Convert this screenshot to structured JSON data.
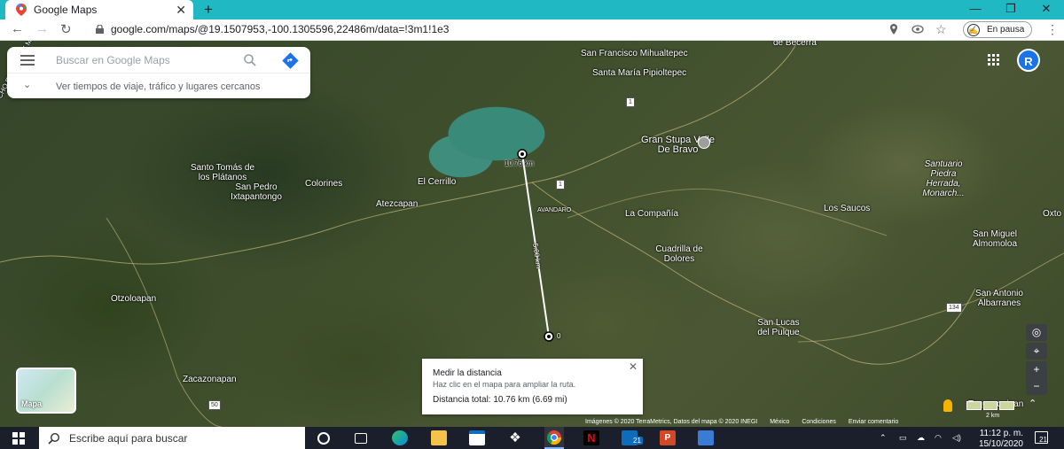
{
  "browser": {
    "tab_title": "Google Maps",
    "url": "google.com/maps/@19.1507953,-100.1305596,22486m/data=!3m1!1e3",
    "profile_status": "En pausa"
  },
  "search": {
    "placeholder": "Buscar en Google Maps",
    "nearby_label": "Ver tiempos de viaje, tráfico y lugares cercanos"
  },
  "account": {
    "initial": "R"
  },
  "map_labels": [
    "San Francisco Mihualtepec",
    "Santa María Pipioltepec",
    "de Becerra",
    "Gran Stupa Valle De Bravo",
    "Santo Tomás de los Plátanos",
    "San Pedro Ixtapantongo",
    "Colorines",
    "El Cerrillo",
    "Atezcapan",
    "Santuario Piedra Herrada, Monarch...",
    "La Compañía",
    "Los Saucos",
    "San Miguel Almomoloa",
    "Cuadrilla de Dolores",
    "San Antonio Albarranes",
    "Otzoloapan",
    "San Lucas del Pulque",
    "Zacazonapan",
    "Tequesquipan",
    "AVANDARO",
    "Oxto",
    "CHO ESTADO DE MÉ"
  ],
  "road_shields": [
    "1",
    "1",
    "134",
    "50"
  ],
  "measure_path": {
    "start_label": "10.76 km",
    "mid_label": "5.00 km",
    "end_label": "0"
  },
  "measure_card": {
    "title": "Medir la distancia",
    "subtitle": "Haz clic en el mapa para ampliar la ruta.",
    "distance": "Distancia total: 10.76 km (6.69 mi)"
  },
  "layers": {
    "label": "Mapa"
  },
  "map_controls": {
    "zoom_in": "+",
    "zoom_out": "−",
    "scale": "2 km"
  },
  "attribution": {
    "imagery": "Imágenes © 2020 TerraMetrics, Datos del mapa © 2020 INEGI",
    "country": "México",
    "terms": "Condiciones",
    "feedback": "Enviar comentario"
  },
  "taskbar": {
    "search_placeholder": "Escribe aquí para buscar",
    "mail_badge": "21",
    "time": "11:12 p. m.",
    "date": "15/10/2020",
    "notification_count": "21"
  },
  "colors": {
    "tab_strip": "#1fb8c3",
    "maps_blue": "#1a73e8",
    "taskbar": "#1a1f2b"
  }
}
